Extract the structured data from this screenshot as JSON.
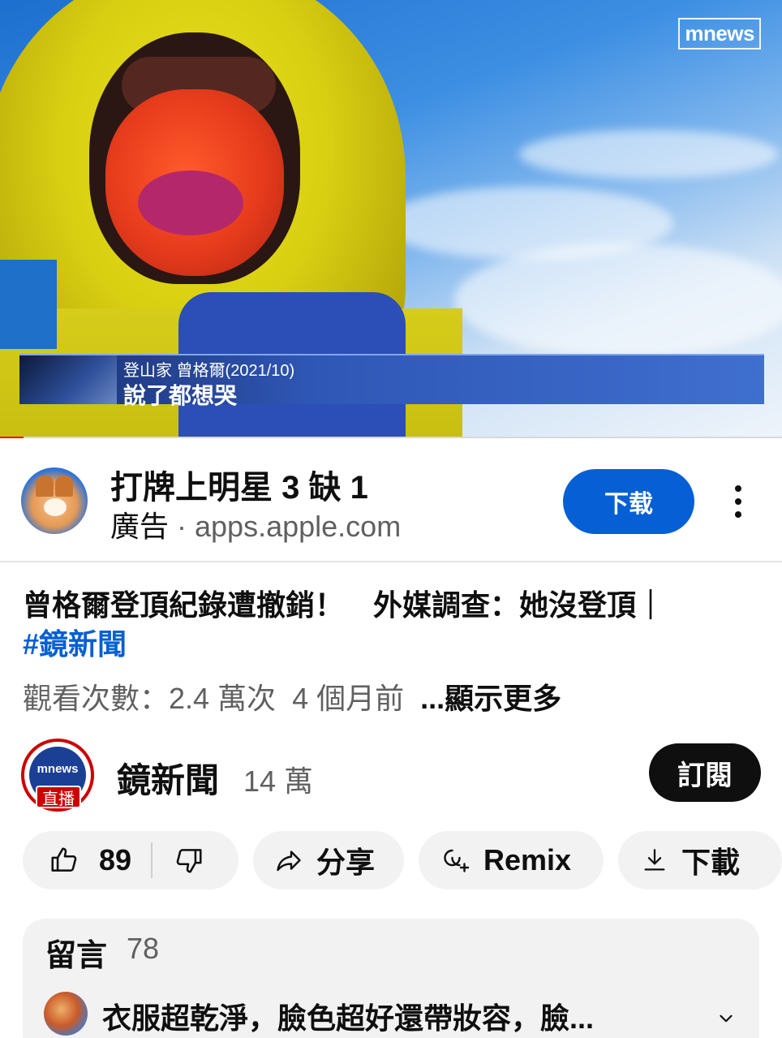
{
  "player": {
    "watermark": "mnews",
    "lower_third": {
      "label": "登山家 曾格爾(2021/10)",
      "caption": "說了都想哭"
    },
    "progress_fraction": 0.03,
    "progress_color": "#ff0000"
  },
  "ad": {
    "title": "打牌上明星 3 缺 1",
    "tag": "廣告",
    "separator": " · ",
    "domain": "apps.apple.com",
    "button_label": "下载",
    "button_color": "#065fd4",
    "menu_icon": "more-vert-icon"
  },
  "video": {
    "title": "曾格爾登頂紀錄遭撤銷！　外媒調查：她沒登頂｜",
    "hashtag": "#鏡新聞",
    "views": "觀看次數：2.4 萬次",
    "age": "4 個月前",
    "more": "...顯示更多"
  },
  "channel": {
    "name": "鏡新聞",
    "subscribers": "14 萬",
    "avatar_text": "mnews",
    "live_badge": "直播",
    "subscribe_label": "訂閱"
  },
  "actions": {
    "likes": "89",
    "share": "分享",
    "remix": "Remix",
    "download": "下載"
  },
  "comments": {
    "heading": "留言",
    "count": "78",
    "top_comment": "衣服超乾淨，臉色超好還帶妝容，臉..."
  }
}
